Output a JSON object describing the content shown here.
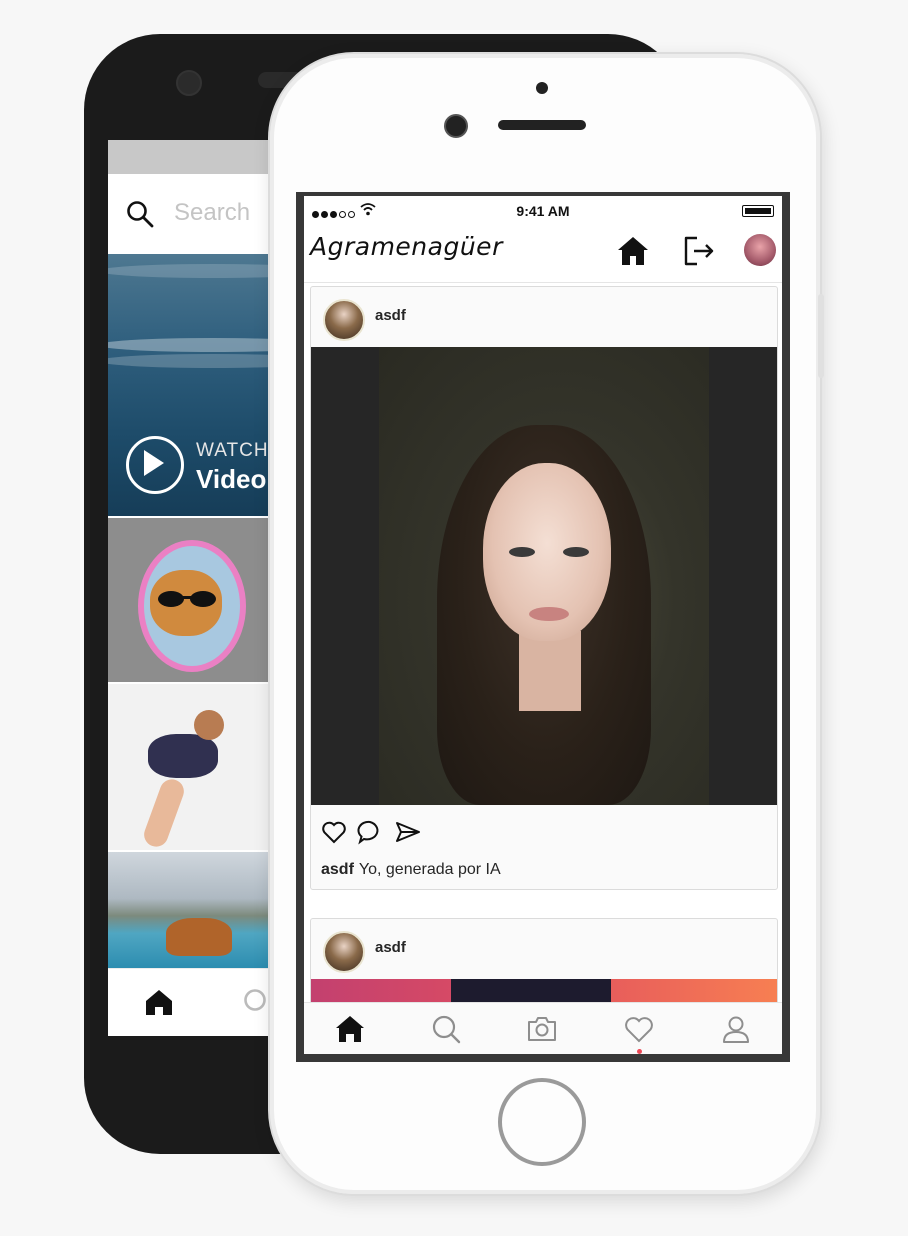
{
  "back_phone": {
    "search": {
      "placeholder": "Search"
    },
    "video_tile": {
      "watch_label": "WATCH",
      "video_label": "Video"
    }
  },
  "app": {
    "status_bar": {
      "time": "9:41 AM"
    },
    "header": {
      "logo": "Agramenagüer"
    },
    "posts": [
      {
        "username": "asdf",
        "caption_user": "asdf",
        "caption_text": "Yo, generada por IA"
      },
      {
        "username": "asdf"
      }
    ],
    "tabs": [
      "home-icon",
      "search-icon",
      "camera-icon",
      "heart-icon",
      "profile-icon"
    ],
    "colors": {
      "notification_dot": "#ed4956",
      "accent_gradient_start": "#c3406f",
      "accent_gradient_end": "#f77f52"
    }
  }
}
